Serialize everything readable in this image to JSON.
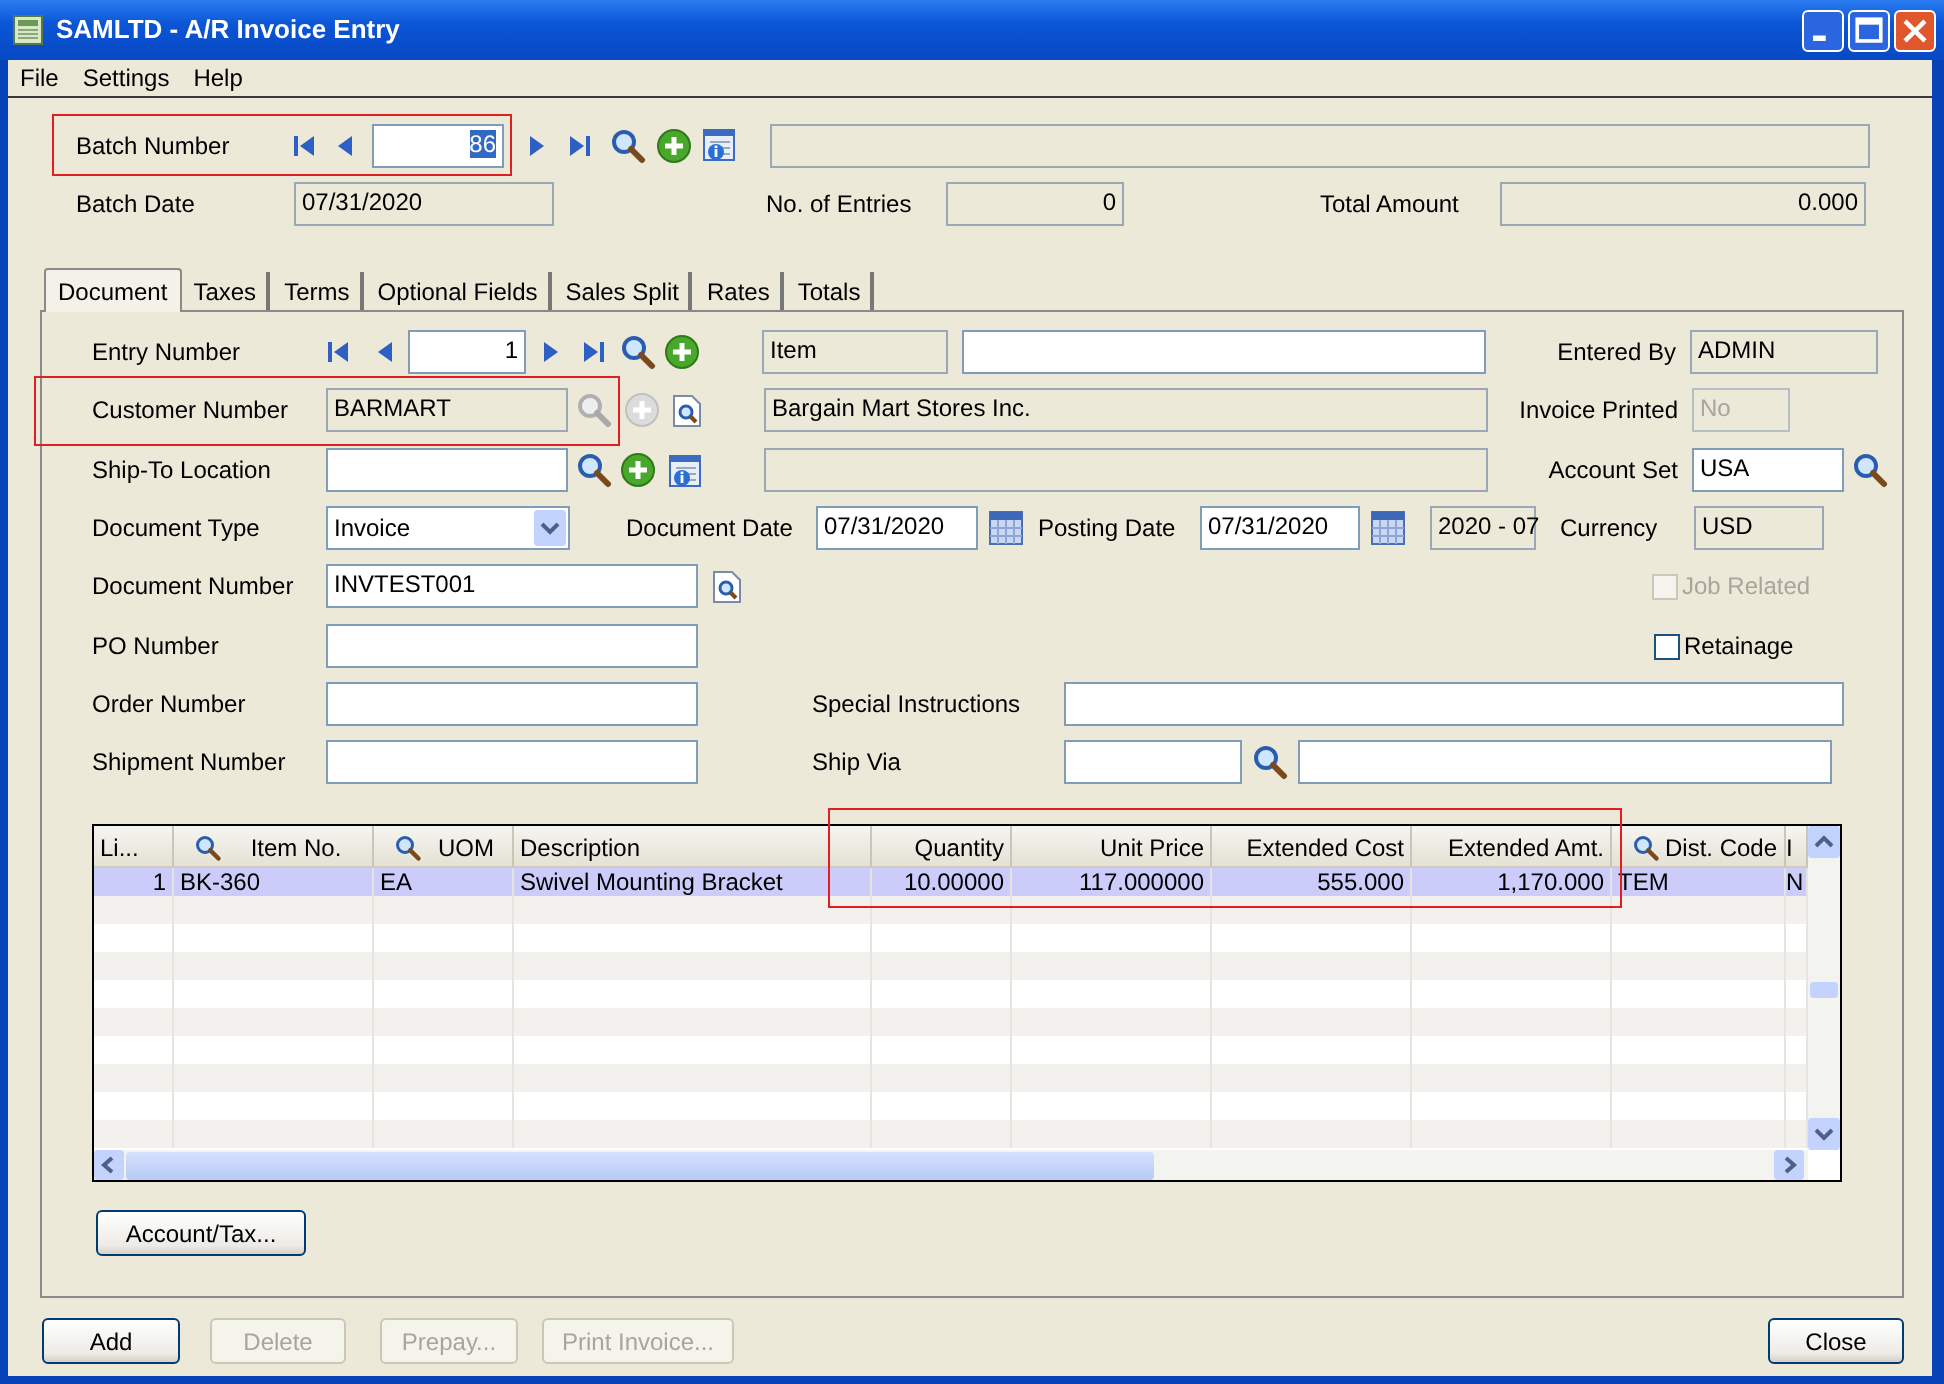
{
  "window": {
    "title": "SAMLTD - A/R Invoice Entry"
  },
  "menu": [
    {
      "label": "File"
    },
    {
      "label": "Settings"
    },
    {
      "label": "Help"
    }
  ],
  "batch": {
    "highlighted": true,
    "label": "Batch Number",
    "value": "86",
    "value_selected": true
  },
  "batch_date": {
    "label": "Batch Date",
    "value": "07/31/2020",
    "read_only": true
  },
  "entries": {
    "label": "No. of Entries",
    "value": "0",
    "read_only": true
  },
  "total": {
    "label": "Total Amount",
    "value": "0.000",
    "read_only": true
  },
  "tabs": [
    {
      "label": "Document",
      "selected": true
    },
    {
      "label": "Taxes",
      "selected": false
    },
    {
      "label": "Terms",
      "selected": false
    },
    {
      "label": "Optional Fields",
      "selected": false
    },
    {
      "label": "Sales Split",
      "selected": false
    },
    {
      "label": "Rates",
      "selected": false
    },
    {
      "label": "Totals",
      "selected": false
    }
  ],
  "entry": {
    "label": "Entry Number",
    "value": "1"
  },
  "item": {
    "value": "Item",
    "read_only": true
  },
  "entered_by": {
    "label": "Entered By",
    "value": "ADMIN",
    "read_only": true
  },
  "customer": {
    "highlighted": true,
    "label": "Customer Number",
    "value": "BARMART",
    "read_only": true,
    "lookup_disabled": true,
    "name": "Bargain Mart Stores Inc."
  },
  "invoice_printed": {
    "label": "Invoice Printed",
    "value": "No",
    "disabled": true
  },
  "ship_to": {
    "label": "Ship-To Location"
  },
  "account_set": {
    "label": "Account Set",
    "value": "USA",
    "read_only": false
  },
  "document_type": {
    "label": "Document Type",
    "value": "Invoice"
  },
  "document_date": {
    "label": "Document Date",
    "value": "07/31/2020",
    "read_only": false
  },
  "posting_date": {
    "label": "Posting Date",
    "value": "07/31/2020",
    "read_only": false
  },
  "period": {
    "value": "2020 - 07",
    "read_only": true
  },
  "currency": {
    "label": "Currency",
    "value": "USD",
    "read_only": true
  },
  "document_number": {
    "label": "Document Number",
    "value": "INVTEST001",
    "read_only": false
  },
  "job_related": {
    "label": "Job Related",
    "checked": false,
    "disabled": true
  },
  "po_number": {
    "label": "PO Number"
  },
  "retainage": {
    "label": "Retainage",
    "checked": false,
    "disabled": false
  },
  "order_number": {
    "label": "Order Number"
  },
  "special_instructions": {
    "label": "Special Instructions"
  },
  "shipment_number": {
    "label": "Shipment Number"
  },
  "ship_via": {
    "label": "Ship Via"
  },
  "grid": {
    "columns": [
      {
        "label": "Li...",
        "kind": "number",
        "lookup": false,
        "highlighted": false
      },
      {
        "label": "Item No.",
        "kind": "text",
        "lookup": true,
        "highlighted": false
      },
      {
        "label": "UOM",
        "kind": "text",
        "lookup": true,
        "highlighted": false
      },
      {
        "label": "Description",
        "kind": "text",
        "lookup": false,
        "highlighted": false
      },
      {
        "label": "Quantity",
        "kind": "number",
        "lookup": false,
        "highlighted": true
      },
      {
        "label": "Unit Price",
        "kind": "number",
        "lookup": false,
        "highlighted": true
      },
      {
        "label": "Extended Cost",
        "kind": "number",
        "lookup": false,
        "highlighted": true
      },
      {
        "label": "Extended Amt.",
        "kind": "number",
        "lookup": false,
        "highlighted": true
      },
      {
        "label": "Dist. Code",
        "kind": "text",
        "lookup": true,
        "highlighted": false
      },
      {
        "label": "I",
        "kind": "text",
        "lookup": false,
        "highlighted": false
      }
    ],
    "rows": [
      {
        "selected": true,
        "cells": [
          "1",
          "BK-360",
          "EA",
          "Swivel Mounting Bracket",
          "10.00000",
          "117.000000",
          "555.000",
          "1,170.000",
          "TEM",
          "N"
        ]
      }
    ]
  },
  "grid_button": {
    "label": "Account/Tax...",
    "disabled": false
  },
  "footer_buttons": [
    {
      "label": "Add",
      "disabled": false
    },
    {
      "label": "Delete",
      "disabled": true
    },
    {
      "label": "Prepay...",
      "disabled": true
    },
    {
      "label": "Print Invoice...",
      "disabled": true
    },
    {
      "label": "Close",
      "disabled": false
    }
  ]
}
